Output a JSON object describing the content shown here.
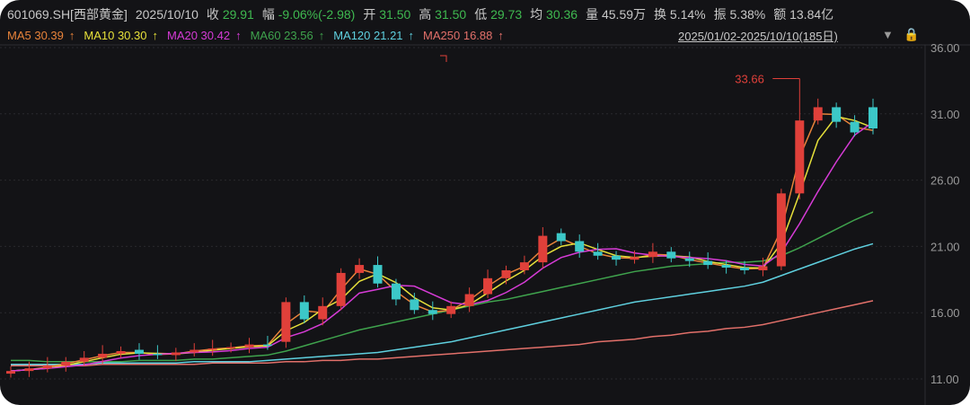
{
  "header": {
    "symbol": "601069.SH[西部黄金]",
    "date": "2025/10/10",
    "close_label": "收",
    "close": "29.91",
    "change_label": "幅",
    "change": "-9.06%(-2.98)",
    "open_label": "开",
    "open": "31.50",
    "high_label": "高",
    "high": "31.50",
    "low_label": "低",
    "low": "29.73",
    "avg_label": "均",
    "avg": "30.36",
    "volume_label": "量",
    "volume": "45.59万",
    "turnover_label": "换",
    "turnover": "5.14%",
    "amplitude_label": "振",
    "amplitude": "5.38%",
    "amount_label": "额",
    "amount": "13.84亿"
  },
  "ma_legend": [
    {
      "label": "MA5 30.39",
      "arrow": "↑",
      "color": "#e8833a"
    },
    {
      "label": "MA10 30.30",
      "arrow": "↑",
      "color": "#e6e03a"
    },
    {
      "label": "MA20 30.42",
      "arrow": "↑",
      "color": "#d63bd6"
    },
    {
      "label": "MA60 23.56",
      "arrow": "↑",
      "color": "#3fa34d"
    },
    {
      "label": "MA120 21.21",
      "arrow": "↑",
      "color": "#5fd0df"
    },
    {
      "label": "MA250 16.88",
      "arrow": "↑",
      "color": "#e2706a"
    }
  ],
  "range_label": "2025/01/02-2025/10/10(185日)",
  "colors": {
    "up": "#e0403a",
    "down": "#3cc8c8",
    "grid": "#2a2a2e"
  },
  "chart_data": {
    "type": "candlestick",
    "ylim": [
      11,
      36
    ],
    "yticks": [
      "36.00",
      "31.00",
      "26.00",
      "21.00",
      "16.00",
      "11.00"
    ],
    "ytick_values": [
      36,
      31,
      26,
      21,
      16,
      11
    ],
    "annotation": {
      "label": "33.66",
      "value": 33.66,
      "index": 43
    },
    "close": [
      11.6,
      11.8,
      12.0,
      12.3,
      12.6,
      12.9,
      13.1,
      12.9,
      12.8,
      13.0,
      13.2,
      13.3,
      13.4,
      13.6,
      13.5,
      16.8,
      15.5,
      16.5,
      19.0,
      19.6,
      18.2,
      17.0,
      16.2,
      15.9,
      16.5,
      17.4,
      18.6,
      19.2,
      19.8,
      21.8,
      21.4,
      20.6,
      20.3,
      20.0,
      20.2,
      20.6,
      20.1,
      19.9,
      19.6,
      19.4,
      19.2,
      19.5,
      25.0,
      30.5,
      31.5,
      30.4,
      29.6,
      29.9
    ],
    "open": [
      11.4,
      11.6,
      11.8,
      12.0,
      12.3,
      12.6,
      12.9,
      13.2,
      12.9,
      12.8,
      13.0,
      13.2,
      13.3,
      13.4,
      13.6,
      13.8,
      16.8,
      15.5,
      16.5,
      19.0,
      19.6,
      18.2,
      17.0,
      16.2,
      15.9,
      16.5,
      17.4,
      18.6,
      19.2,
      19.8,
      22.0,
      21.4,
      20.6,
      20.3,
      20.0,
      20.2,
      20.6,
      20.1,
      19.9,
      19.6,
      19.4,
      19.2,
      19.5,
      25.0,
      30.5,
      31.5,
      30.4,
      31.5
    ],
    "series": [
      {
        "name": "MA60",
        "color": "#3fa34d",
        "values": [
          12.4,
          12.4,
          12.3,
          12.3,
          12.3,
          12.3,
          12.3,
          12.4,
          12.4,
          12.4,
          12.5,
          12.5,
          12.6,
          12.7,
          12.8,
          13.1,
          13.5,
          13.9,
          14.3,
          14.7,
          15.0,
          15.3,
          15.6,
          15.9,
          16.2,
          16.5,
          16.8,
          17.0,
          17.3,
          17.6,
          17.9,
          18.2,
          18.5,
          18.8,
          19.1,
          19.3,
          19.5,
          19.6,
          19.7,
          19.8,
          19.8,
          19.9,
          20.3,
          20.9,
          21.6,
          22.3,
          23.0,
          23.6
        ]
      },
      {
        "name": "MA120",
        "color": "#5fd0df",
        "values": [
          12.1,
          12.1,
          12.1,
          12.1,
          12.1,
          12.2,
          12.2,
          12.2,
          12.2,
          12.2,
          12.3,
          12.3,
          12.3,
          12.3,
          12.4,
          12.5,
          12.6,
          12.7,
          12.8,
          12.9,
          13.0,
          13.2,
          13.4,
          13.6,
          13.8,
          14.1,
          14.4,
          14.7,
          15.0,
          15.3,
          15.6,
          15.9,
          16.2,
          16.5,
          16.8,
          17.0,
          17.2,
          17.4,
          17.6,
          17.8,
          18.0,
          18.3,
          18.8,
          19.3,
          19.8,
          20.3,
          20.8,
          21.2
        ]
      },
      {
        "name": "MA250",
        "color": "#e2706a",
        "values": [
          12.0,
          12.0,
          12.0,
          12.0,
          12.0,
          12.1,
          12.1,
          12.1,
          12.1,
          12.1,
          12.1,
          12.2,
          12.2,
          12.2,
          12.2,
          12.3,
          12.3,
          12.4,
          12.4,
          12.5,
          12.5,
          12.6,
          12.7,
          12.8,
          12.9,
          13.0,
          13.1,
          13.2,
          13.3,
          13.4,
          13.5,
          13.6,
          13.8,
          13.9,
          14.0,
          14.2,
          14.3,
          14.5,
          14.6,
          14.8,
          14.9,
          15.1,
          15.4,
          15.7,
          16.0,
          16.3,
          16.6,
          16.9
        ]
      }
    ]
  }
}
